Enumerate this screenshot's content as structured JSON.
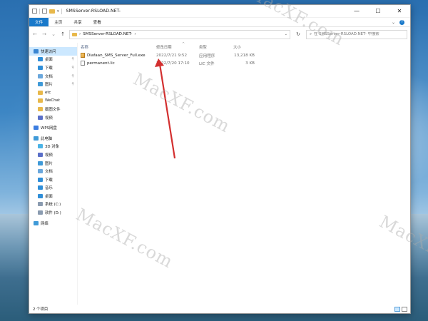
{
  "window": {
    "title": "SMSServer-RSLOAD.NET-",
    "controls": {
      "minimize": "—",
      "maximize": "☐",
      "close": "✕"
    }
  },
  "ribbon": {
    "tabs": [
      "文件",
      "主页",
      "共享",
      "查看"
    ]
  },
  "address": {
    "path": "SMSServer-RSLOAD.NET-",
    "separator": "›",
    "search_placeholder": "在 SMSServer-RSLOAD.NET- 中搜索"
  },
  "nav_pane": {
    "items": [
      {
        "label": "快速访问",
        "icon": "star-icon",
        "color": "#3a85d1",
        "pinned": false,
        "selected": true
      },
      {
        "label": "桌面",
        "icon": "desktop-icon",
        "color": "#2f8ed8",
        "pinned": true
      },
      {
        "label": "下载",
        "icon": "download-icon",
        "color": "#2f8ed8",
        "pinned": true
      },
      {
        "label": "文档",
        "icon": "document-icon",
        "color": "#6aa7dc",
        "pinned": true
      },
      {
        "label": "图片",
        "icon": "picture-icon",
        "color": "#3f9ad8",
        "pinned": true
      },
      {
        "label": "etc",
        "icon": "folder-icon",
        "color": "#e8b84a",
        "pinned": false
      },
      {
        "label": "WeChat",
        "icon": "folder-icon",
        "color": "#e8b84a",
        "pinned": false
      },
      {
        "label": "截图文件",
        "icon": "folder-icon",
        "color": "#e8b84a",
        "pinned": false
      },
      {
        "label": "视频",
        "icon": "video-icon",
        "color": "#5a6fc8",
        "pinned": false
      },
      {
        "label": "WPS网盘",
        "icon": "cloud-icon",
        "color": "#3b7de0",
        "pinned": false
      },
      {
        "label": "此电脑",
        "icon": "computer-icon",
        "color": "#3f9ad8",
        "pinned": false
      },
      {
        "label": "3D 对象",
        "icon": "cube-icon",
        "color": "#4bb3e6",
        "pinned": false
      },
      {
        "label": "视频",
        "icon": "video-icon",
        "color": "#5a6fc8",
        "pinned": false
      },
      {
        "label": "图片",
        "icon": "picture-icon",
        "color": "#3f9ad8",
        "pinned": false
      },
      {
        "label": "文档",
        "icon": "document-icon",
        "color": "#6aa7dc",
        "pinned": false
      },
      {
        "label": "下载",
        "icon": "download-icon",
        "color": "#2f8ed8",
        "pinned": false
      },
      {
        "label": "音乐",
        "icon": "music-icon",
        "color": "#2f8ed8",
        "pinned": false
      },
      {
        "label": "桌面",
        "icon": "desktop-icon",
        "color": "#2f8ed8",
        "pinned": false
      },
      {
        "label": "系统 (C:)",
        "icon": "drive-icon",
        "color": "#8a9bb0",
        "pinned": false
      },
      {
        "label": "软件 (D:)",
        "icon": "drive-icon",
        "color": "#8a9bb0",
        "pinned": false
      },
      {
        "label": "网络",
        "icon": "network-icon",
        "color": "#3f9ad8",
        "pinned": false
      }
    ]
  },
  "file_list": {
    "columns": [
      "名称",
      "修改日期",
      "类型",
      "大小"
    ],
    "rows": [
      {
        "name": "Diafaan_SMS_Server_Full.exe",
        "date": "2022/7/21 9:52",
        "type": "应用程序",
        "size": "13,218 KB",
        "icon": "exe-icon"
      },
      {
        "name": "permanent.lic",
        "date": "2022/7/20 17:10",
        "type": "LIC 文件",
        "size": "3 KB",
        "icon": "file-icon"
      }
    ]
  },
  "status": {
    "count": "2 个项目"
  },
  "watermark": "MacXF.com",
  "annotation_color": "#d32f2f"
}
